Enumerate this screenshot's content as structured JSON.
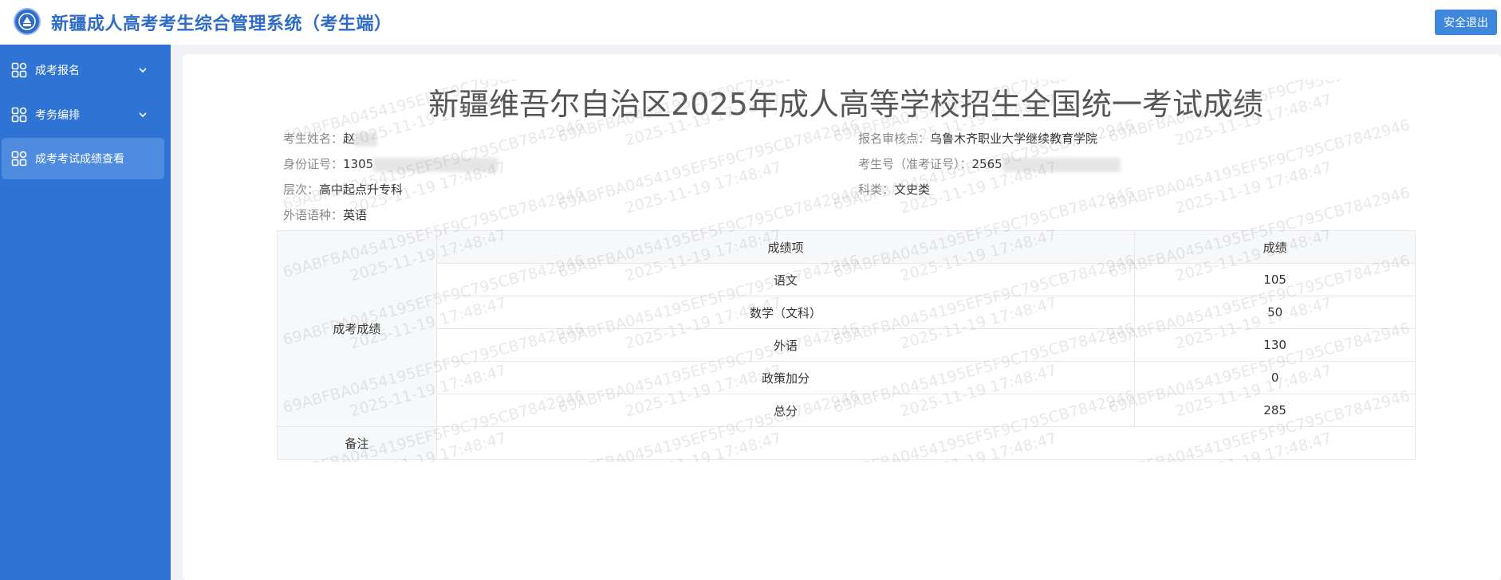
{
  "app": {
    "title": "新疆成人高考考生综合管理系统（考生端）",
    "logout_label": "安全退出"
  },
  "sidebar": {
    "items": [
      {
        "label": "成考报名",
        "icon": "grid-icon",
        "expandable": true
      },
      {
        "label": "考务编排",
        "icon": "grid-icon",
        "expandable": true
      },
      {
        "label": "成考考试成绩查看",
        "icon": "grid-icon",
        "expandable": false,
        "active": true
      }
    ]
  },
  "page": {
    "title": "新疆维吾尔自治区2025年成人高等学校招生全国统一考试成绩"
  },
  "student": {
    "name_label": "考生姓名：",
    "name_value": "赵",
    "id_label": "身份证号：",
    "id_value": "1305",
    "level_label": "层次：",
    "level_value": "高中起点升专科",
    "language_label": "外语语种：",
    "language_value": "英语",
    "site_label": "报名审核点：",
    "site_value": "乌鲁木齐职业大学继续教育学院",
    "exam_no_label": "考生号（准考证号）：",
    "exam_no_value": "2565",
    "subject_label": "科类：",
    "subject_value": "文史类"
  },
  "scores": {
    "section_label": "成考成绩",
    "header_item": "成绩项",
    "header_score": "成绩",
    "rows": [
      {
        "item": "语文",
        "score": "105"
      },
      {
        "item": "数学（文科）",
        "score": "50"
      },
      {
        "item": "外语",
        "score": "130"
      },
      {
        "item": "政策加分",
        "score": "0"
      },
      {
        "item": "总分",
        "score": "285"
      }
    ],
    "remark_label": "备注",
    "remark_value": ""
  },
  "watermark": {
    "line1": "69ABFBA0454195EF5F9C795CB7842946",
    "line2": "2025-11-19 17:48:47"
  },
  "colors": {
    "brand": "#2f6bc9",
    "sidebar": "#2f74d4",
    "sidebar_active": "#4f8ce0",
    "button": "#3e87dc"
  }
}
